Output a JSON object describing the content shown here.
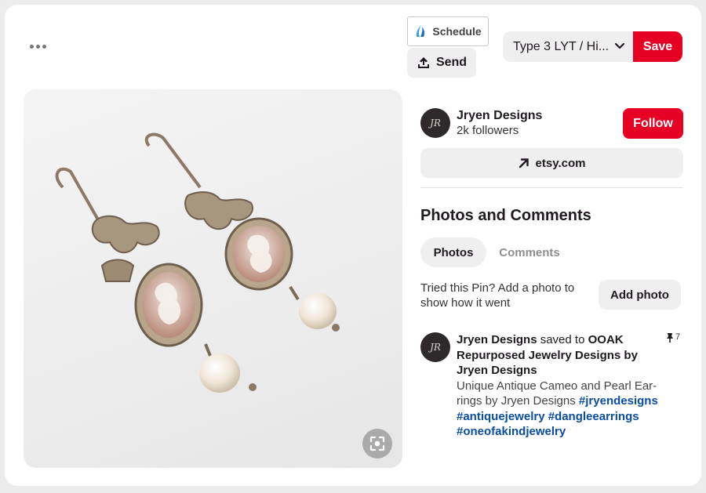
{
  "toolbar": {
    "schedule_label": "Schedule",
    "send_label": "Send",
    "board_select_value": "Type 3 LYT / Hi...",
    "save_label": "Save"
  },
  "creator": {
    "avatar_initials": "JR",
    "name": "Jryen Designs",
    "followers": "2k followers",
    "follow_label": "Follow"
  },
  "link": {
    "label": "etsy.com"
  },
  "photos_comments": {
    "title": "Photos and Comments",
    "tabs": [
      {
        "label": "Photos",
        "active": true
      },
      {
        "label": "Comments",
        "active": false
      }
    ],
    "tried_text": "Tried this Pin? Add a photo to show how it went",
    "add_photo_label": "Add photo"
  },
  "activity": {
    "avatar_initials": "JR",
    "user": "Jryen Designs",
    "action": "saved to",
    "board": "OOAK Repurposed Jewelry Designs by Jryen Designs",
    "description": "Unique Antique Cameo and Pearl Ear-rings by Jryen Designs",
    "hashtags": "#jryendesigns #antiquejewelry #dangleearrings #oneofakindjewelry",
    "pin_count": "7"
  },
  "icons": {
    "more": "more-dots-icon",
    "schedule": "sail-icon",
    "send": "share-upload-icon",
    "chevron": "chevron-down-icon",
    "link": "arrow-up-right-icon",
    "visual_search": "visual-search-icon",
    "pin": "pushpin-icon"
  },
  "colors": {
    "primary_red": "#e60023",
    "hashtag_blue": "#0a4da2"
  }
}
